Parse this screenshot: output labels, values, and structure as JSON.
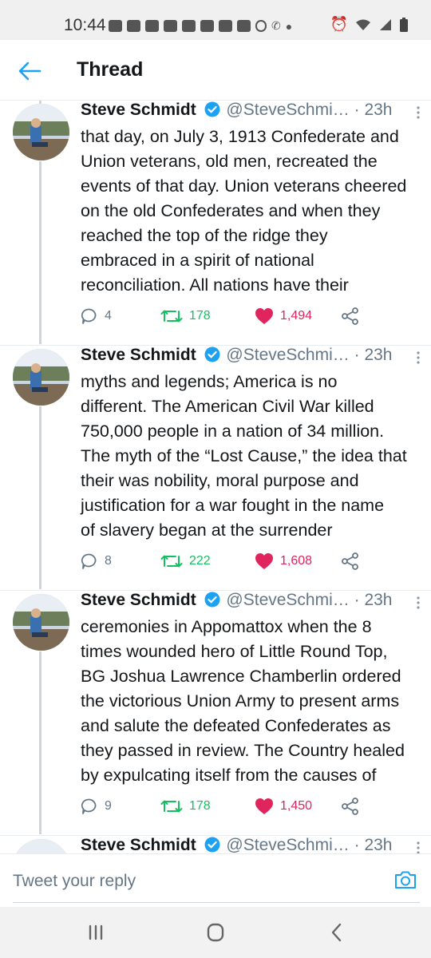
{
  "status_bar": {
    "time": "10:44",
    "left_icons": [
      "message-icon",
      "chat-icon",
      "facebook-icon",
      "youtube-icon",
      "youtube-icon",
      "youtube-icon",
      "youtube-icon",
      "youtube-icon",
      "voicemail-icon",
      "missed-call-icon",
      "dot-icon"
    ],
    "right_icons": [
      "alarm-icon",
      "wifi-icon",
      "signal-icon",
      "battery-icon"
    ]
  },
  "header": {
    "title": "Thread"
  },
  "colors": {
    "accent": "#1da1f2",
    "retweet": "#17bf63",
    "like": "#e0245e",
    "muted": "#657786"
  },
  "tweets": [
    {
      "name": "Steve Schmidt",
      "handle": "@SteveSchmi…",
      "time": "· 23h",
      "lines": [
        "that day, on July 3, 1913 Confederate and",
        "Union veterans, old men, recreated the",
        "events of that day. Union veterans cheered",
        "on the old Confederates and when they",
        "reached the top of the ridge they",
        "embraced in a spirit of national",
        "reconciliation. All nations have their"
      ],
      "replies": "4",
      "retweets": "178",
      "likes": "1,494"
    },
    {
      "name": "Steve Schmidt",
      "handle": "@SteveSchmi…",
      "time": "· 23h",
      "lines": [
        "myths and legends; America is no",
        "different. The American Civil War killed",
        "750,000 people in a nation of 34 million.",
        "The myth of the “Lost Cause,” the idea that",
        "their was nobility, moral purpose and",
        "justification for a war fought in the name",
        "of slavery began at the surrender"
      ],
      "replies": "8",
      "retweets": "222",
      "likes": "1,608"
    },
    {
      "name": "Steve Schmidt",
      "handle": "@SteveSchmi…",
      "time": "· 23h",
      "lines": [
        "ceremonies in Appomattox when the 8",
        "times wounded hero of Little Round Top,",
        "BG Joshua Lawrence Chamberlin ordered",
        "the victorious Union Army to present arms",
        "and salute the defeated Confederates as",
        "they passed in review. The Country healed",
        "by expulcating itself from the causes of"
      ],
      "replies": "9",
      "retweets": "178",
      "likes": "1,450"
    },
    {
      "name": "Steve Schmidt",
      "handle": "@SteveSchmi…",
      "time": "· 23h",
      "lines": [],
      "replies": "",
      "retweets": "",
      "likes": ""
    }
  ],
  "reply_bar": {
    "placeholder": "Tweet your reply"
  },
  "nav_bar": {
    "buttons": [
      "recent-apps",
      "home",
      "back"
    ]
  }
}
